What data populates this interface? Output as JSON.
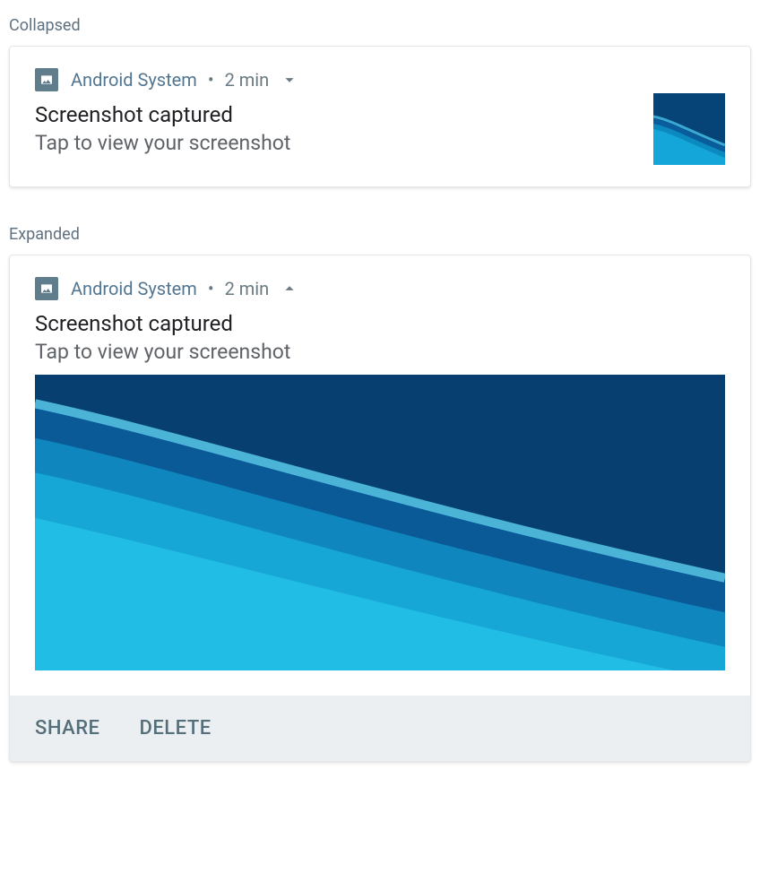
{
  "sections": {
    "collapsed_label": "Collapsed",
    "expanded_label": "Expanded"
  },
  "collapsed": {
    "app_name": "Android  System",
    "timestamp": "2 min",
    "title": "Screenshot captured",
    "body": "Tap to view your screenshot"
  },
  "expanded": {
    "app_name": "Android  System",
    "timestamp": "2 min",
    "title": "Screenshot captured",
    "body": "Tap to view your screenshot",
    "actions": {
      "share": "SHARE",
      "delete": "DELETE"
    }
  },
  "colors": {
    "accent": "#527691",
    "muted": "#6a7a82",
    "action_bg": "#eceff1",
    "action_text": "#546e7a",
    "icon_bg": "#607d8b"
  }
}
